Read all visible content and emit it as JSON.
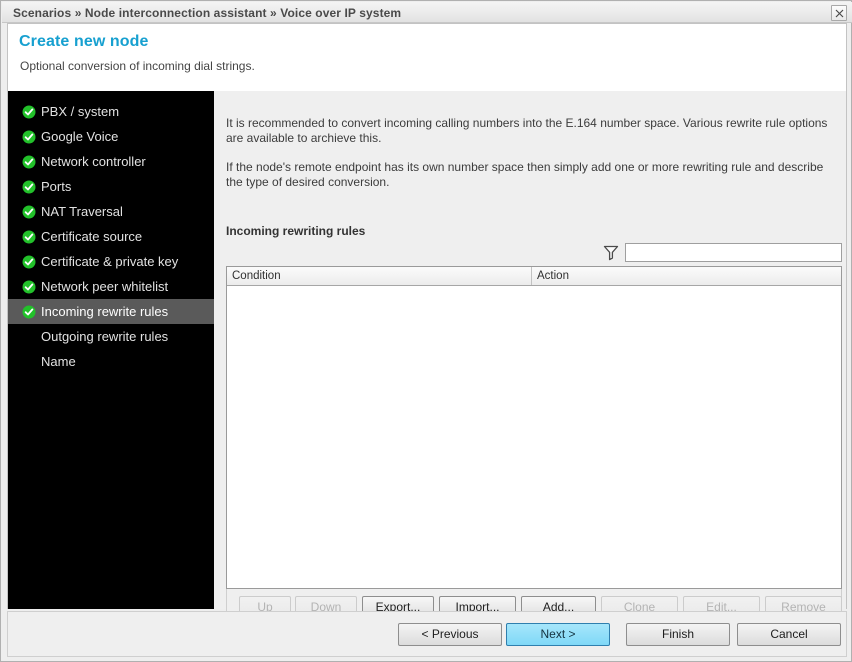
{
  "titlebar": {
    "breadcrumb": "Scenarios » Node interconnection assistant » Voice over IP system",
    "close_label": "X"
  },
  "wizard": {
    "title": "Create new node",
    "subtitle": "Optional conversion of incoming dial strings."
  },
  "sidebar": {
    "steps": [
      {
        "label": "PBX / system",
        "done": true,
        "selected": false
      },
      {
        "label": "Google Voice",
        "done": true,
        "selected": false
      },
      {
        "label": "Network controller",
        "done": true,
        "selected": false
      },
      {
        "label": "Ports",
        "done": true,
        "selected": false
      },
      {
        "label": "NAT Traversal",
        "done": true,
        "selected": false
      },
      {
        "label": "Certificate source",
        "done": true,
        "selected": false
      },
      {
        "label": "Certificate & private key",
        "done": true,
        "selected": false
      },
      {
        "label": "Network peer whitelist",
        "done": true,
        "selected": false
      },
      {
        "label": "Incoming rewrite rules",
        "done": true,
        "selected": true
      },
      {
        "label": "Outgoing rewrite rules",
        "done": false,
        "selected": false
      },
      {
        "label": "Name",
        "done": false,
        "selected": false
      }
    ],
    "check_color": "#22c12a"
  },
  "main": {
    "paragraph1": "It is recommended to convert incoming calling numbers into the E.164 number space. Various rewrite rule options are available to archieve this.",
    "paragraph2": "If the node's remote endpoint has its own number space then simply add one or more rewriting rule and describe the type of desired conversion.",
    "section_label": "Incoming rewriting rules",
    "filter": {
      "icon": "funnel-filter-icon",
      "value": "",
      "placeholder": ""
    },
    "table": {
      "columns": [
        "Condition",
        "Action"
      ],
      "rows": []
    },
    "table_buttons": [
      {
        "label": "Up",
        "enabled": false
      },
      {
        "label": "Down",
        "enabled": false
      },
      {
        "label": "Export...",
        "enabled": true
      },
      {
        "label": "Import...",
        "enabled": true
      },
      {
        "label": "Add...",
        "enabled": true
      },
      {
        "label": "Clone",
        "enabled": false
      },
      {
        "label": "Edit...",
        "enabled": false
      },
      {
        "label": "Remove",
        "enabled": false
      }
    ]
  },
  "footer": {
    "buttons": [
      {
        "label": "< Previous",
        "default": false
      },
      {
        "label": "Next >",
        "default": true
      },
      {
        "label": "Finish",
        "default": false
      },
      {
        "label": "Cancel",
        "default": false
      }
    ]
  },
  "colors": {
    "accent": "#17a0d0",
    "sidebar_bg": "#000000",
    "selected_step_bg": "#5a5a5a",
    "default_button": "#7fd8f7"
  }
}
